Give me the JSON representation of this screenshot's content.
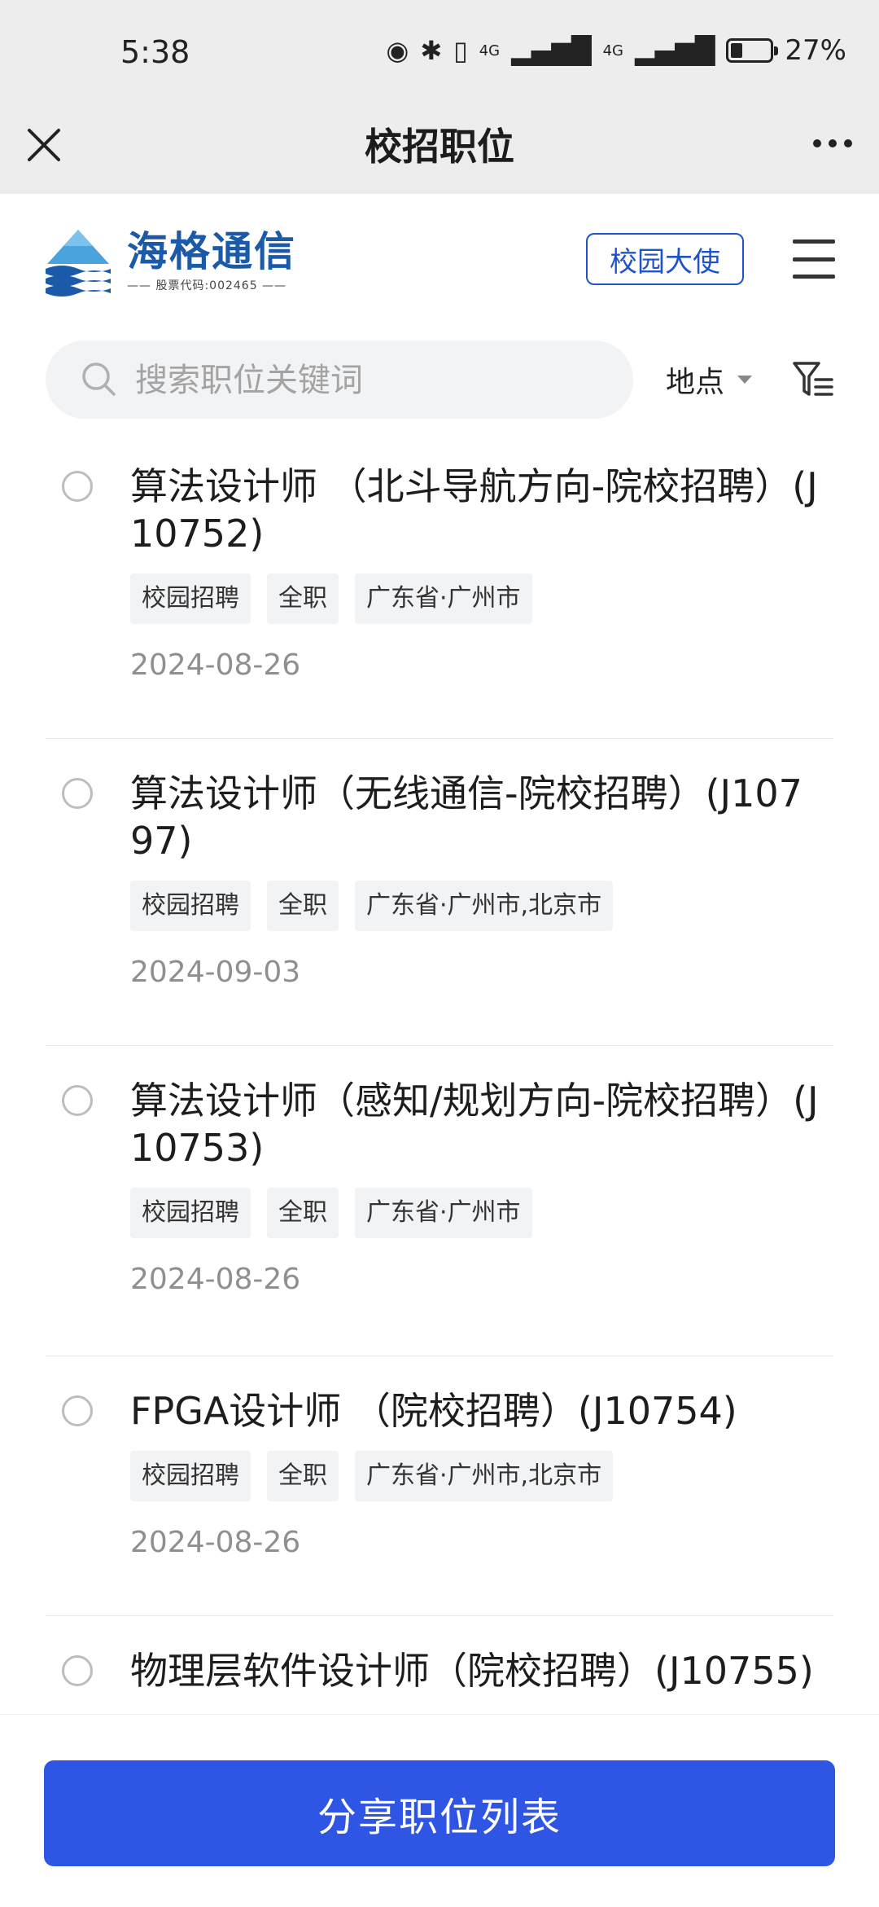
{
  "status_bar": {
    "time": "5:38",
    "network_1": "4G",
    "network_2": "4G",
    "battery_percent": "27%",
    "battery_level": 0.27
  },
  "title_bar": {
    "title": "校招职位"
  },
  "brand": {
    "logo_name": "海格通信",
    "logo_sub": "—— 股票代码:002465 ——",
    "ambassador_label": "校园大使"
  },
  "search": {
    "placeholder": "搜索职位关键词",
    "location_label": "地点"
  },
  "jobs": [
    {
      "title": "算法设计师 （北斗导航方向-院校招聘）(J10752)",
      "tags": [
        "校园招聘",
        "全职",
        "广东省·广州市"
      ],
      "date": "2024-08-26"
    },
    {
      "title": "算法设计师（无线通信-院校招聘）(J10797)",
      "tags": [
        "校园招聘",
        "全职",
        "广东省·广州市,北京市"
      ],
      "date": "2024-09-03"
    },
    {
      "title": "算法设计师（感知/规划方向-院校招聘）(J10753)",
      "tags": [
        "校园招聘",
        "全职",
        "广东省·广州市"
      ],
      "date": "2024-08-26"
    },
    {
      "title": "FPGA设计师 （院校招聘）(J10754)",
      "tags": [
        "校园招聘",
        "全职",
        "广东省·广州市,北京市"
      ],
      "date": "2024-08-26"
    },
    {
      "title": "物理层软件设计师（院校招聘）(J10755)",
      "tags": [],
      "date": ""
    }
  ],
  "footer": {
    "share_label": "分享职位列表"
  },
  "colors": {
    "primary": "#2f55e4",
    "brand_blue": "#1a5aa8",
    "header_bg": "#ededed"
  }
}
